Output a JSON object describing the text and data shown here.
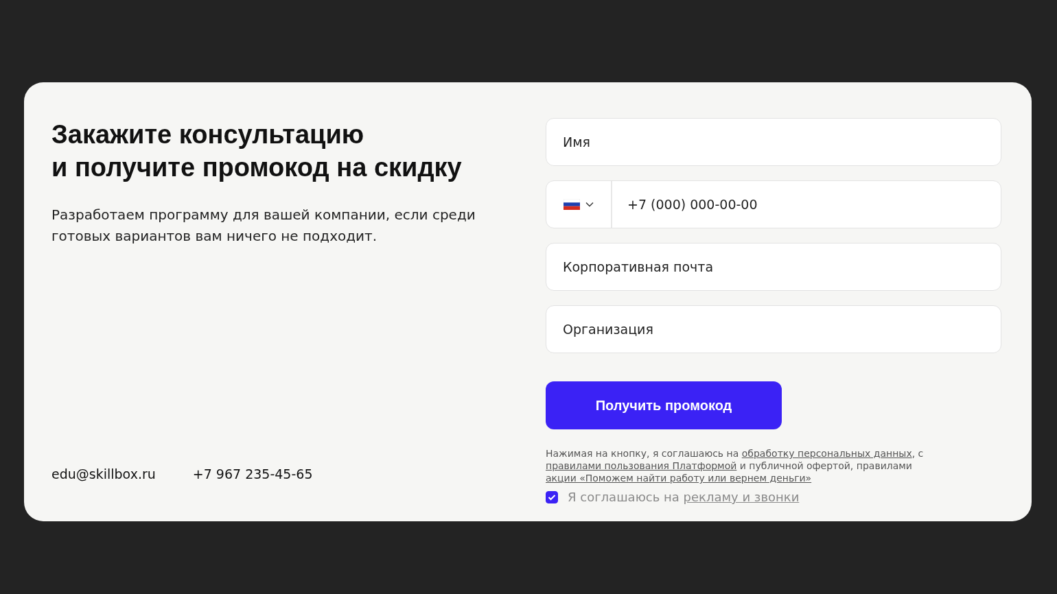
{
  "heading": [
    "Закажите консультацию",
    "и получите промокод на скидку"
  ],
  "description": "Разработаем программу для вашей компании, если среди готовых вариантов вам ничего не подходит.",
  "contacts": {
    "email": "edu@skillbox.ru",
    "phone": "+7 967 235-45-65"
  },
  "form": {
    "name_field": {
      "placeholder": "Имя"
    },
    "phone_field": {
      "placeholder": "+7 (000) 000-00-00"
    },
    "email_field": {
      "placeholder": "Корпоративная почта"
    },
    "organization_field": {
      "placeholder": "Организация"
    },
    "submit": "Получить промокод",
    "legal": [
      {
        "kind": "text",
        "text": "Нажимая на кнопку, я соглашаюсь на "
      },
      {
        "kind": "link",
        "text": "обработку персональных данных"
      },
      {
        "kind": "text",
        "text": ", с "
      },
      {
        "kind": "link",
        "text": "правилами пользования Платформой"
      },
      {
        "kind": "text",
        "text": " и публичной офертой, правилами "
      },
      {
        "kind": "link",
        "text": "акции «Поможем найти работу или вернем деньги»"
      }
    ],
    "consent": {
      "checked": true,
      "text": "Я соглашаюсь на ",
      "link": "рекламу и звонки"
    }
  }
}
